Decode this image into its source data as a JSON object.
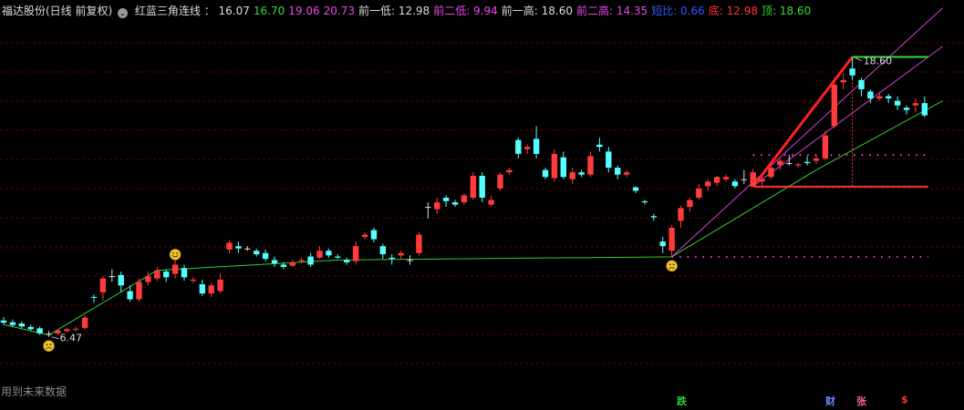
{
  "header": {
    "stock_name": "福达股份(日线 前复权)",
    "indicator_name": "红蓝三角连线",
    "values": [
      {
        "label": "",
        "value": "16.07",
        "color": "#dddddd"
      },
      {
        "label": "",
        "value": "16.70",
        "color": "#33dd33"
      },
      {
        "label": "",
        "value": "19.06",
        "color": "#ee44ee"
      },
      {
        "label": "",
        "value": "20.73",
        "color": "#ee44ee"
      },
      {
        "label": "前一低",
        "value": "12.98",
        "color": "#dddddd"
      },
      {
        "label": "前二低",
        "value": "9.94",
        "color": "#ee44ee"
      },
      {
        "label": "前一高",
        "value": "18.60",
        "color": "#dddddd"
      },
      {
        "label": "前二高",
        "value": "14.35",
        "color": "#ee44ee"
      },
      {
        "label": "短比",
        "value": "0.66",
        "color": "#3355ff"
      },
      {
        "label": "底",
        "value": "12.98",
        "color": "#ff3333"
      },
      {
        "label": "顶",
        "value": "18.60",
        "color": "#33dd33"
      }
    ]
  },
  "footnote": "用到未来数据",
  "bottom_markers": [
    {
      "text": "跌",
      "color": "#33cc33"
    },
    {
      "text": "财",
      "color": "#6688ff"
    },
    {
      "text": "张",
      "color": "#ff6688"
    },
    {
      "text": "$",
      "color": "#ff3333"
    }
  ],
  "colors": {
    "up": "#ff3b3b",
    "down": "#54ffff",
    "trend_line": "#33cc33",
    "channel": "#cc44cc",
    "grid": "#5a0000"
  },
  "chart_data": {
    "type": "candlestick",
    "ylim": [
      4.8,
      20.2
    ],
    "annotations": [
      {
        "text": "6.47",
        "kind": "low-point"
      },
      {
        "text": "18.60",
        "kind": "high-point"
      }
    ],
    "candles": [
      [
        7.18,
        7.08,
        7.32,
        7.0
      ],
      [
        7.1,
        6.98,
        7.22,
        6.92
      ],
      [
        7.05,
        6.92,
        7.14,
        6.84
      ],
      [
        6.9,
        6.8,
        7.0,
        6.72
      ],
      [
        6.84,
        6.62,
        6.92,
        6.56
      ],
      [
        6.6,
        6.6,
        6.72,
        6.47
      ],
      [
        6.62,
        6.75,
        6.8,
        6.55
      ],
      [
        6.72,
        6.8,
        6.86,
        6.66
      ],
      [
        6.78,
        6.82,
        6.9,
        6.7
      ],
      [
        6.86,
        7.3,
        7.4,
        6.8
      ],
      [
        8.2,
        8.18,
        8.3,
        7.95
      ],
      [
        8.4,
        9.0,
        9.1,
        8.05
      ],
      [
        9.1,
        9.1,
        9.4,
        8.85
      ],
      [
        9.15,
        8.7,
        9.3,
        8.4
      ],
      [
        8.45,
        8.1,
        8.7,
        8.0
      ],
      [
        8.1,
        8.85,
        9.0,
        8.0
      ],
      [
        8.85,
        9.1,
        9.3,
        8.7
      ],
      [
        9.0,
        9.35,
        9.5,
        8.9
      ],
      [
        9.3,
        9.05,
        9.4,
        8.85
      ],
      [
        9.2,
        9.6,
        9.8,
        9.0
      ],
      [
        9.45,
        9.05,
        9.6,
        8.9
      ],
      [
        8.9,
        8.95,
        9.05,
        8.8
      ],
      [
        8.75,
        8.35,
        8.95,
        8.25
      ],
      [
        8.35,
        8.7,
        8.8,
        8.2
      ],
      [
        8.45,
        8.95,
        9.2,
        8.35
      ],
      [
        10.25,
        10.55,
        10.65,
        10.1
      ],
      [
        10.4,
        10.3,
        10.6,
        10.1
      ],
      [
        10.3,
        10.3,
        10.4,
        10.2
      ],
      [
        10.2,
        10.05,
        10.3,
        9.95
      ],
      [
        10.1,
        9.85,
        10.25,
        9.75
      ],
      [
        9.8,
        9.65,
        9.95,
        9.5
      ],
      [
        9.6,
        9.5,
        9.7,
        9.4
      ],
      [
        9.55,
        9.7,
        9.8,
        9.5
      ],
      [
        9.75,
        9.8,
        9.9,
        9.65
      ],
      [
        9.95,
        9.6,
        10.1,
        9.5
      ],
      [
        9.9,
        10.2,
        10.4,
        9.85
      ],
      [
        10.2,
        10.0,
        10.3,
        9.9
      ],
      [
        9.95,
        9.9,
        10.05,
        9.85
      ],
      [
        9.8,
        9.7,
        9.9,
        9.6
      ],
      [
        9.75,
        10.4,
        10.6,
        9.6
      ],
      [
        10.8,
        10.9,
        11.0,
        10.7
      ],
      [
        11.1,
        10.7,
        11.2,
        10.55
      ],
      [
        10.4,
        10.05,
        10.5,
        9.85
      ],
      [
        9.9,
        9.85,
        10.05,
        9.6
      ],
      [
        10.0,
        10.1,
        10.2,
        9.85
      ],
      [
        9.8,
        9.8,
        10.0,
        9.6
      ],
      [
        10.1,
        10.9,
        11.0,
        10.0
      ],
      [
        12.1,
        12.1,
        12.3,
        11.6
      ],
      [
        12.0,
        12.3,
        12.5,
        11.8
      ],
      [
        12.5,
        12.35,
        12.6,
        12.1
      ],
      [
        12.3,
        12.2,
        12.4,
        12.1
      ],
      [
        12.3,
        12.6,
        12.7,
        12.2
      ],
      [
        12.5,
        13.45,
        13.6,
        12.4
      ],
      [
        13.45,
        12.5,
        13.6,
        12.3
      ],
      [
        12.2,
        12.4,
        12.6,
        12.1
      ],
      [
        12.9,
        13.5,
        13.6,
        12.8
      ],
      [
        13.6,
        13.7,
        13.8,
        13.5
      ],
      [
        15.0,
        14.4,
        15.1,
        14.2
      ],
      [
        14.6,
        14.7,
        14.8,
        14.4
      ],
      [
        15.05,
        14.4,
        15.6,
        14.2
      ],
      [
        13.7,
        13.4,
        13.8,
        13.3
      ],
      [
        13.35,
        14.4,
        14.6,
        13.2
      ],
      [
        14.25,
        13.4,
        14.5,
        13.3
      ],
      [
        13.3,
        13.6,
        13.8,
        13.1
      ],
      [
        13.6,
        13.5,
        13.7,
        13.4
      ],
      [
        13.5,
        14.3,
        14.5,
        13.4
      ],
      [
        14.8,
        14.7,
        15.1,
        14.5
      ],
      [
        14.5,
        13.8,
        14.7,
        13.6
      ],
      [
        13.8,
        13.5,
        13.9,
        13.3
      ],
      [
        13.5,
        13.6,
        13.7,
        13.4
      ],
      [
        12.95,
        12.8,
        13.0,
        12.7
      ],
      [
        12.35,
        12.3,
        12.4,
        12.2
      ],
      [
        11.7,
        11.65,
        11.8,
        11.5
      ],
      [
        10.6,
        10.4,
        10.8,
        10.1
      ],
      [
        10.2,
        11.2,
        11.3,
        9.94
      ],
      [
        11.5,
        12.05,
        12.15,
        11.2
      ],
      [
        12.1,
        12.4,
        12.5,
        11.9
      ],
      [
        12.5,
        12.9,
        13.1,
        12.4
      ],
      [
        13.0,
        13.2,
        13.3,
        12.8
      ],
      [
        13.15,
        13.4,
        13.45,
        13.0
      ],
      [
        13.3,
        13.4,
        13.5,
        13.2
      ],
      [
        13.2,
        13.0,
        13.3,
        12.9
      ],
      [
        13.3,
        13.3,
        13.7,
        13.1
      ],
      [
        12.98,
        13.6,
        13.75,
        12.98
      ],
      [
        13.2,
        13.3,
        13.4,
        13.0
      ],
      [
        13.4,
        13.8,
        14.0,
        13.3
      ],
      [
        13.9,
        14.1,
        14.2,
        13.7
      ],
      [
        14.0,
        14.0,
        14.35,
        13.9
      ],
      [
        13.9,
        13.95,
        14.0,
        13.8
      ],
      [
        14.05,
        14.0,
        14.3,
        13.9
      ],
      [
        14.1,
        14.2,
        14.35,
        13.95
      ],
      [
        14.2,
        15.2,
        15.4,
        14.1
      ],
      [
        15.6,
        17.4,
        17.7,
        15.5
      ],
      [
        17.5,
        17.6,
        17.9,
        17.2
      ],
      [
        18.1,
        17.8,
        18.6,
        17.6
      ],
      [
        17.6,
        17.2,
        17.7,
        16.9
      ],
      [
        17.1,
        16.8,
        17.2,
        16.6
      ],
      [
        16.8,
        16.9,
        17.1,
        16.7
      ],
      [
        16.9,
        16.8,
        17.0,
        16.6
      ],
      [
        16.7,
        16.5,
        16.9,
        16.3
      ],
      [
        16.4,
        16.3,
        16.5,
        16.1
      ],
      [
        16.5,
        16.6,
        16.8,
        16.2
      ],
      [
        16.6,
        16.07,
        16.9,
        16.0
      ]
    ],
    "trend_line": [
      [
        0,
        7.0
      ],
      [
        5,
        6.55
      ],
      [
        17,
        9.35
      ],
      [
        37,
        9.8
      ],
      [
        74,
        9.94
      ],
      [
        90,
        13.7
      ],
      [
        104,
        16.7
      ]
    ],
    "channel_lines": [
      {
        "from": [
          74,
          9.94
        ],
        "to": [
          104,
          20.73
        ]
      },
      {
        "from": [
          83,
          13.0
        ],
        "to": [
          104,
          19.06
        ]
      }
    ],
    "red_segment": {
      "from": [
        83,
        12.98
      ],
      "to": [
        94,
        18.6
      ]
    },
    "levels": [
      {
        "value": 18.6,
        "from": 94,
        "to": 102,
        "color": "#33dd33",
        "style": "solid"
      },
      {
        "value": 12.98,
        "from": 83,
        "to": 102,
        "color": "#ff3333",
        "style": "solid"
      },
      {
        "value": 14.35,
        "from": 83,
        "to": 102,
        "color": "#ee44ee",
        "style": "dotted"
      },
      {
        "value": 9.94,
        "from": 74,
        "to": 102,
        "color": "#ee44ee",
        "style": "dotted"
      }
    ],
    "drop_line": {
      "index": 94,
      "from": 18.6,
      "to": 12.98
    },
    "markers": [
      {
        "index": 5,
        "value": 6.47,
        "face": "sad"
      },
      {
        "index": 19,
        "value": 9.8,
        "face": "happy"
      },
      {
        "index": 74,
        "value": 9.94,
        "face": "sad"
      }
    ]
  }
}
